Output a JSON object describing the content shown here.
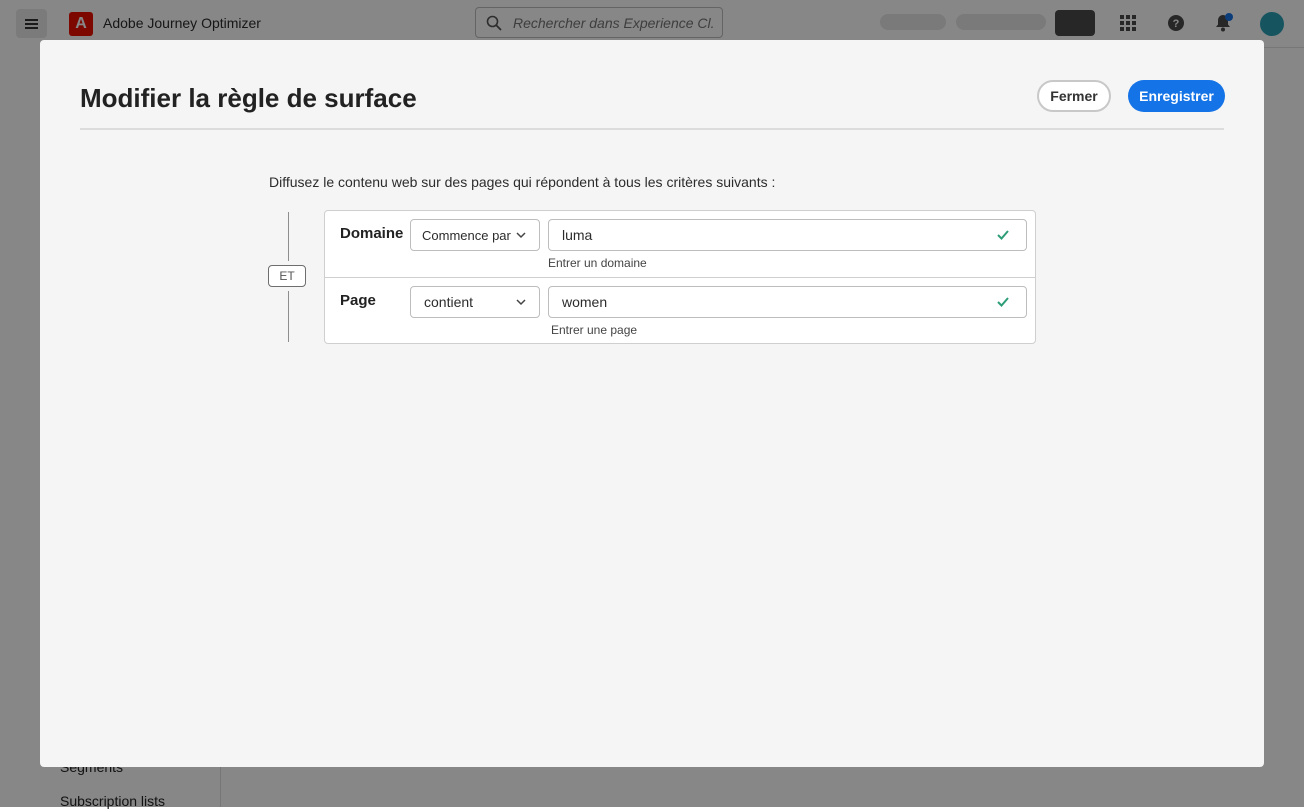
{
  "topbar": {
    "app_title": "Adobe Journey Optimizer",
    "search_placeholder": "Rechercher dans Experience Cl...",
    "icons": [
      "hamburger-icon",
      "adobe-logo-icon",
      "search-icon",
      "apps-grid-icon",
      "help-icon",
      "bell-icon",
      "avatar"
    ]
  },
  "leftrail": {
    "visible_items": [
      {
        "label": "Segments"
      },
      {
        "label": "Subscription lists"
      }
    ]
  },
  "dialog": {
    "title": "Modifier la règle de surface",
    "close_label": "Fermer",
    "save_label": "Enregistrer",
    "instruction": "Diffusez le contenu web sur des pages qui répondent à tous les critères suivants :",
    "operator": "ET",
    "rules": [
      {
        "label": "Domaine",
        "condition": "Commence par",
        "value": "luma",
        "helper": "Entrer un domaine"
      },
      {
        "label": "Page",
        "condition": "contient",
        "value": "women",
        "helper": "Entrer une page"
      }
    ]
  },
  "colors": {
    "accent": "#1473e6",
    "valid_check": "#2d9d78",
    "brand_red": "#eb1000"
  }
}
